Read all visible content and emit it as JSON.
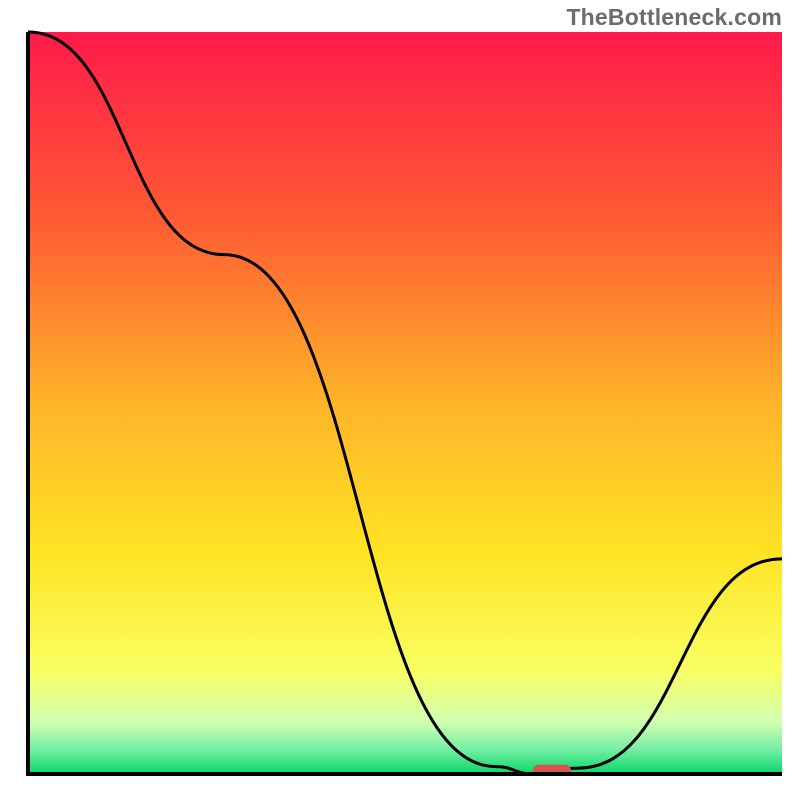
{
  "watermark": "TheBottleneck.com",
  "chart_data": {
    "type": "line",
    "title": "",
    "xlabel": "",
    "ylabel": "",
    "xlim": [
      0,
      100
    ],
    "ylim": [
      0,
      100
    ],
    "x": [
      0,
      26,
      62,
      67,
      73,
      100
    ],
    "series": [
      {
        "name": "bottleneck-curve",
        "values": [
          100,
          70,
          1,
          0,
          0.8,
          29
        ]
      }
    ],
    "gradient_stops": [
      {
        "offset": 0.0,
        "color": "#ff1a4b"
      },
      {
        "offset": 0.25,
        "color": "#ff5a34"
      },
      {
        "offset": 0.5,
        "color": "#ffb42a"
      },
      {
        "offset": 0.7,
        "color": "#ffe324"
      },
      {
        "offset": 0.86,
        "color": "#f8ff62"
      },
      {
        "offset": 0.93,
        "color": "#d2ffb0"
      },
      {
        "offset": 0.965,
        "color": "#7af0a6"
      },
      {
        "offset": 1.0,
        "color": "#09d66a"
      }
    ],
    "marker": {
      "x": 69.5,
      "y": 0.5,
      "color": "#d9534f"
    }
  },
  "plot": {
    "outer_w": 800,
    "outer_h": 800,
    "inner_x": 28,
    "inner_y": 32,
    "inner_w": 754,
    "inner_h": 742,
    "axis_color": "#000000",
    "axis_width": 4
  }
}
